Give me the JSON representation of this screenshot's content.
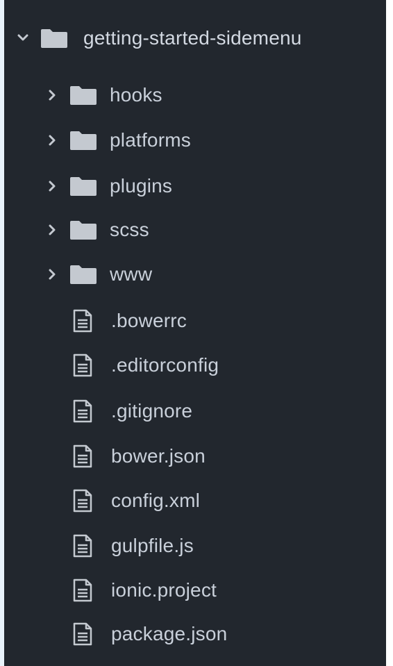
{
  "tree": {
    "root": {
      "label": "getting-started-sidemenu",
      "icon": "folder-icon",
      "expanded": true
    },
    "folders": [
      {
        "label": "hooks",
        "icon": "folder-icon",
        "expanded": false
      },
      {
        "label": "platforms",
        "icon": "folder-icon",
        "expanded": false
      },
      {
        "label": "plugins",
        "icon": "folder-icon",
        "expanded": false
      },
      {
        "label": "scss",
        "icon": "folder-icon",
        "expanded": false
      },
      {
        "label": "www",
        "icon": "folder-icon",
        "expanded": false
      }
    ],
    "files": [
      {
        "label": ".bowerrc",
        "icon": "file-icon"
      },
      {
        "label": ".editorconfig",
        "icon": "file-icon"
      },
      {
        "label": ".gitignore",
        "icon": "file-icon"
      },
      {
        "label": "bower.json",
        "icon": "file-icon"
      },
      {
        "label": "config.xml",
        "icon": "file-icon"
      },
      {
        "label": "gulpfile.js",
        "icon": "file-icon"
      },
      {
        "label": "ionic.project",
        "icon": "file-icon"
      },
      {
        "label": "package.json",
        "icon": "file-icon"
      }
    ]
  },
  "colors": {
    "panel_background": "#22272e",
    "text": "#c9d0da",
    "icon": "#c4c9d0"
  }
}
